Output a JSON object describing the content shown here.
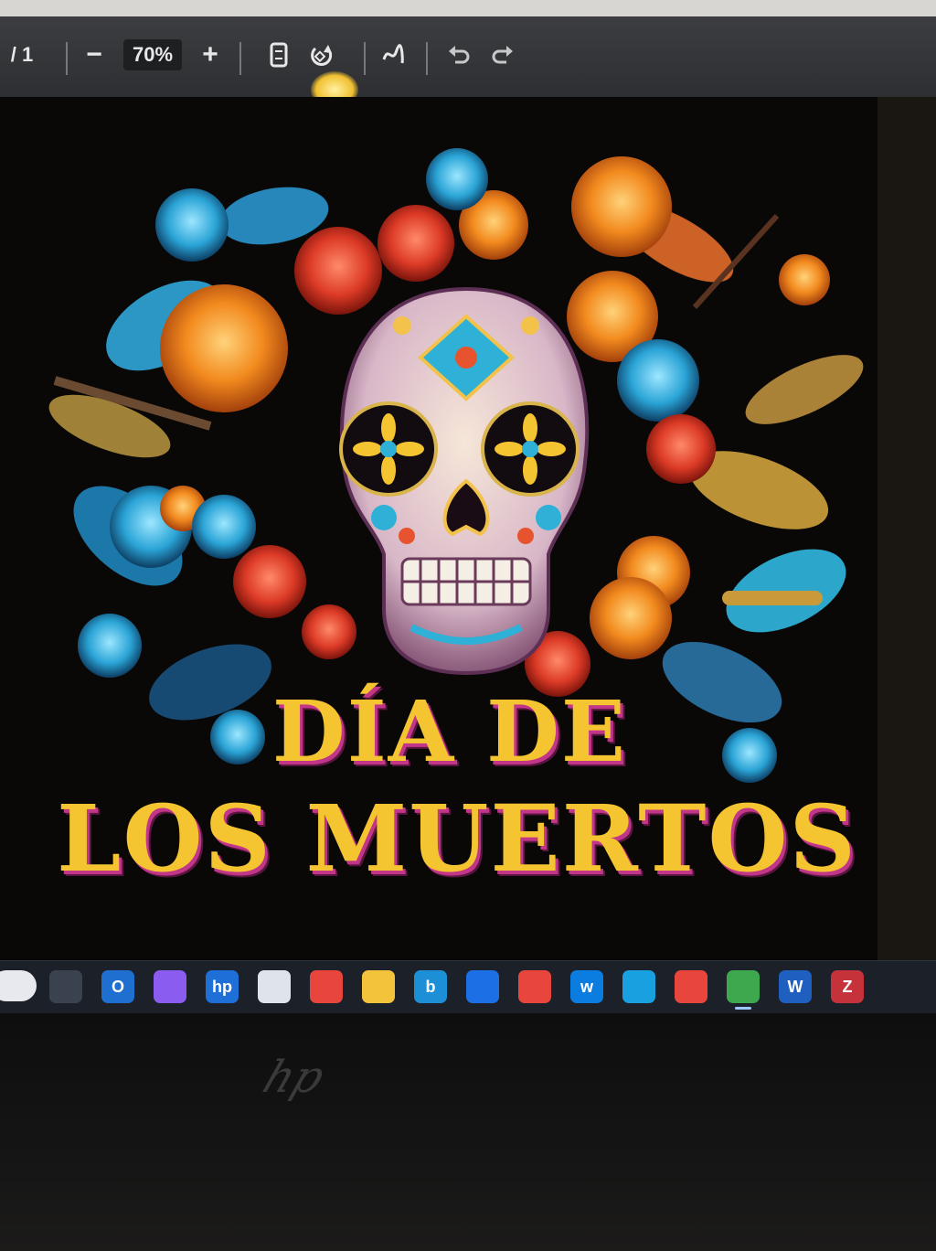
{
  "toolbar": {
    "page_indicator": "/ 1",
    "zoom_out": "−",
    "zoom_value": "70%",
    "zoom_in": "+",
    "icons": [
      "fit-page-icon",
      "rotate-icon",
      "draw-icon",
      "undo-icon",
      "redo-icon"
    ]
  },
  "document": {
    "title_line1": "DÍA DE",
    "title_line2": "LOS MUERTOS"
  },
  "taskbar": {
    "apps": [
      {
        "name": "task-view",
        "label": ""
      },
      {
        "name": "outlook",
        "label": "O",
        "color": "#1f6fd1"
      },
      {
        "name": "copilot",
        "label": "",
        "color": "#8a5cf0"
      },
      {
        "name": "hp",
        "label": "hp",
        "color": "#1e6fd8"
      },
      {
        "name": "microsoft-store",
        "label": "",
        "color": "#dfe3ea"
      },
      {
        "name": "chrome",
        "label": "",
        "color": "#e8453c"
      },
      {
        "name": "file-explorer",
        "label": "",
        "color": "#f3c33c"
      },
      {
        "name": "bing",
        "label": "b",
        "color": "#1d8fd6"
      },
      {
        "name": "dropbox",
        "label": "",
        "color": "#1d6fe6"
      },
      {
        "name": "chrome-profile",
        "label": "",
        "color": "#e8453c"
      },
      {
        "name": "webex",
        "label": "w",
        "color": "#0b7de0"
      },
      {
        "name": "edge",
        "label": "",
        "color": "#18a0e0"
      },
      {
        "name": "chrome-profile-2",
        "label": "",
        "color": "#e8453c"
      },
      {
        "name": "chrome-active",
        "label": "",
        "color": "#3ea84f"
      },
      {
        "name": "word",
        "label": "W",
        "color": "#1f5fbf"
      },
      {
        "name": "zoom-app",
        "label": "Z",
        "color": "#c6323a"
      }
    ]
  },
  "colors": {
    "title_fill": "#f5c431",
    "title_shadow": "#c2368a",
    "toolbar_bg": "#3c3d40",
    "taskbar_bg": "#1c2129"
  }
}
